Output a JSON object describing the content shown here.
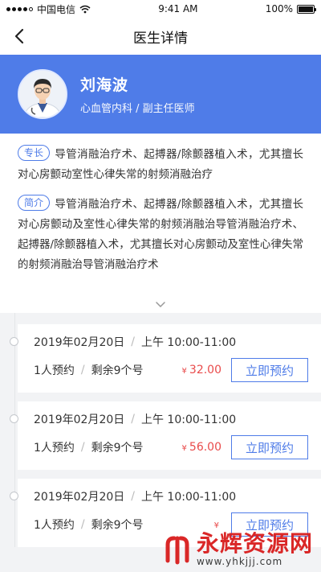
{
  "statusbar": {
    "carrier": "中国电信",
    "time": "9:41 AM",
    "battery": "100%",
    "battery_level": 1.0
  },
  "navbar": {
    "title": "医生详情",
    "back_icon": "chevron-left-icon"
  },
  "doctor": {
    "name": "刘海波",
    "department": "心血管内科 / 副主任医师"
  },
  "intro": {
    "specialty_tag": "专长",
    "specialty_text": "导管消融治疗术、起搏器/除颤器植入术，尤其擅长对心房颤动室性心律失常的射频消融治疗",
    "profile_tag": "简介",
    "profile_text": "导管消融治疗术、起搏器/除颤器植入术，尤其擅长对心房颤动及室性心律失常的射频消融治导管消融治疗术、起搏器/除颤器植入术，尤其擅长对心房颤动及室性心律失常的射频消融治导管消融治疗术",
    "expand_icon": "chevron-down-icon"
  },
  "slots": [
    {
      "date": "2019年02月20日",
      "period": "上午 10:00-11:00",
      "booked": "1人预约",
      "remaining": "剩余9个号",
      "currency": "¥",
      "price": "32.00",
      "button": "立即预约"
    },
    {
      "date": "2019年02月20日",
      "period": "上午 10:00-11:00",
      "booked": "1人预约",
      "remaining": "剩余9个号",
      "currency": "¥",
      "price": "56.00",
      "button": "立即预约"
    },
    {
      "date": "2019年02月20日",
      "period": "上午 10:00-11:00",
      "booked": "1人预约",
      "remaining": "剩余9个号",
      "currency": "¥",
      "price": "",
      "button": "立即预约"
    }
  ],
  "watermark": {
    "main": "永辉资源网",
    "url": "www.yhkjjj.com"
  },
  "colors": {
    "accent": "#4f7ce8",
    "price": "#e94b4b",
    "watermark": "#d92121"
  }
}
